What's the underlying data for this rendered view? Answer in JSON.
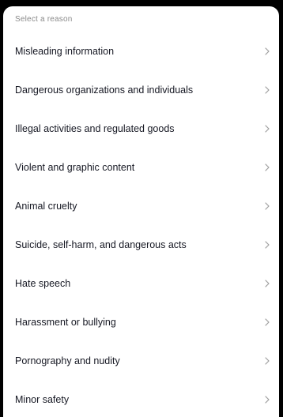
{
  "header": {
    "title": "Select a reason"
  },
  "reasons": [
    {
      "label": "Misleading information",
      "icon": "chevron-right-icon"
    },
    {
      "label": "Dangerous organizations and individuals",
      "icon": "chevron-right-icon"
    },
    {
      "label": "Illegal activities and regulated goods",
      "icon": "chevron-right-icon"
    },
    {
      "label": "Violent and graphic content",
      "icon": "chevron-right-icon"
    },
    {
      "label": "Animal cruelty",
      "icon": "chevron-right-icon"
    },
    {
      "label": "Suicide, self-harm, and dangerous acts",
      "icon": "chevron-right-icon"
    },
    {
      "label": "Hate speech",
      "icon": "chevron-right-icon"
    },
    {
      "label": "Harassment or bullying",
      "icon": "chevron-right-icon"
    },
    {
      "label": "Pornography and nudity",
      "icon": "chevron-right-icon"
    },
    {
      "label": "Minor safety",
      "icon": "chevron-right-icon"
    }
  ],
  "colors": {
    "background": "#000000",
    "sheet": "#ffffff",
    "text": "#161823",
    "muted": "#8a8a8a",
    "chevron": "#9e9e9e"
  }
}
